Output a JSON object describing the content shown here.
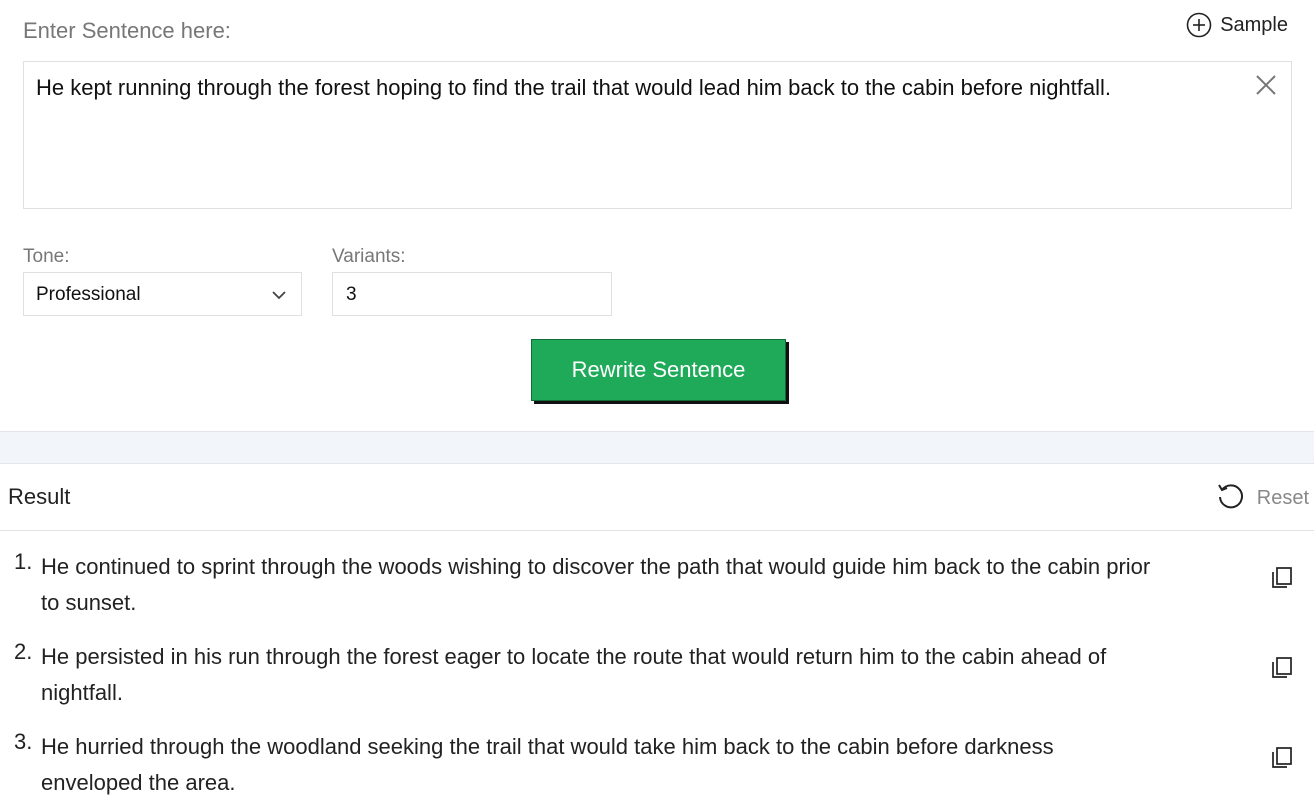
{
  "input": {
    "label": "Enter Sentence here:",
    "sample_label": "Sample",
    "sample_icon": "plus-circle-icon",
    "value": "He kept running through the forest hoping to find the trail that would lead him back to the cabin before nightfall.",
    "clear_icon": "close-icon"
  },
  "options": {
    "tone_label": "Tone:",
    "tone_value": "Professional",
    "variants_label": "Variants:",
    "variants_value": "3"
  },
  "action": {
    "rewrite_label": "Rewrite Sentence",
    "color": "#1faa59"
  },
  "result": {
    "title": "Result",
    "reset_label": "Reset",
    "items": [
      {
        "number": "1.",
        "line1": "He continued to sprint through the woods wishing to discover the path that would guide him back to the cabin prior",
        "line2": "to sunset."
      },
      {
        "number": "2.",
        "line1": "He persisted in his run through the forest eager to locate the route that would return him to the cabin ahead of",
        "line2": "nightfall."
      },
      {
        "number": "3.",
        "line1": "He hurried through the woodland seeking the trail that would take him back to the cabin before darkness",
        "line2": "enveloped the area."
      }
    ]
  }
}
